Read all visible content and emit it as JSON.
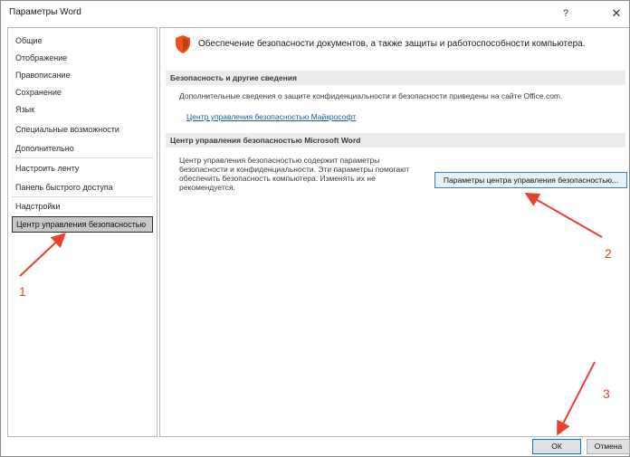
{
  "window": {
    "title": "Параметры Word",
    "help": "?",
    "close": "✕"
  },
  "sidebar": {
    "items": [
      {
        "label": "Общие"
      },
      {
        "label": "Отображение"
      },
      {
        "label": "Правописание"
      },
      {
        "label": "Сохранение"
      },
      {
        "label": "Язык"
      },
      {
        "label": "Специальные возможности"
      },
      {
        "label": "Дополнительно"
      },
      {
        "label": "Настроить ленту"
      },
      {
        "label": "Панель быстрого доступа"
      },
      {
        "label": "Надстройки"
      },
      {
        "label": "Центр управления безопасностью",
        "selected": true
      }
    ]
  },
  "main": {
    "intro": "Обеспечение безопасности документов, а также защиты и работоспособности компьютера.",
    "section1": {
      "header": "Безопасность и другие сведения",
      "text": "Дополнительные сведения о защите конфиденциальности и безопасности приведены на сайте Office.com.",
      "link": "Центр управления безопасностью Майкрософт"
    },
    "section2": {
      "header": "Центр управления безопасностью Microsoft Word",
      "text_lines": [
        "Центр управления безопасностью содержит параметры",
        "безопасности и конфиденциальности. Эти параметры помогают",
        "обеспечить безопасность компьютера. Изменять их не",
        "рекомендуется."
      ],
      "button": "Параметры центра управления безопасностью..."
    }
  },
  "footer": {
    "ok": "ОК",
    "cancel": "Отмена"
  },
  "annotations": {
    "step1": "1",
    "step2": "2",
    "step3": "3",
    "color": "#e8412d"
  },
  "colors": {
    "accent": "#0078d7",
    "link": "#1c5aa6",
    "shield": "#e8531e"
  }
}
